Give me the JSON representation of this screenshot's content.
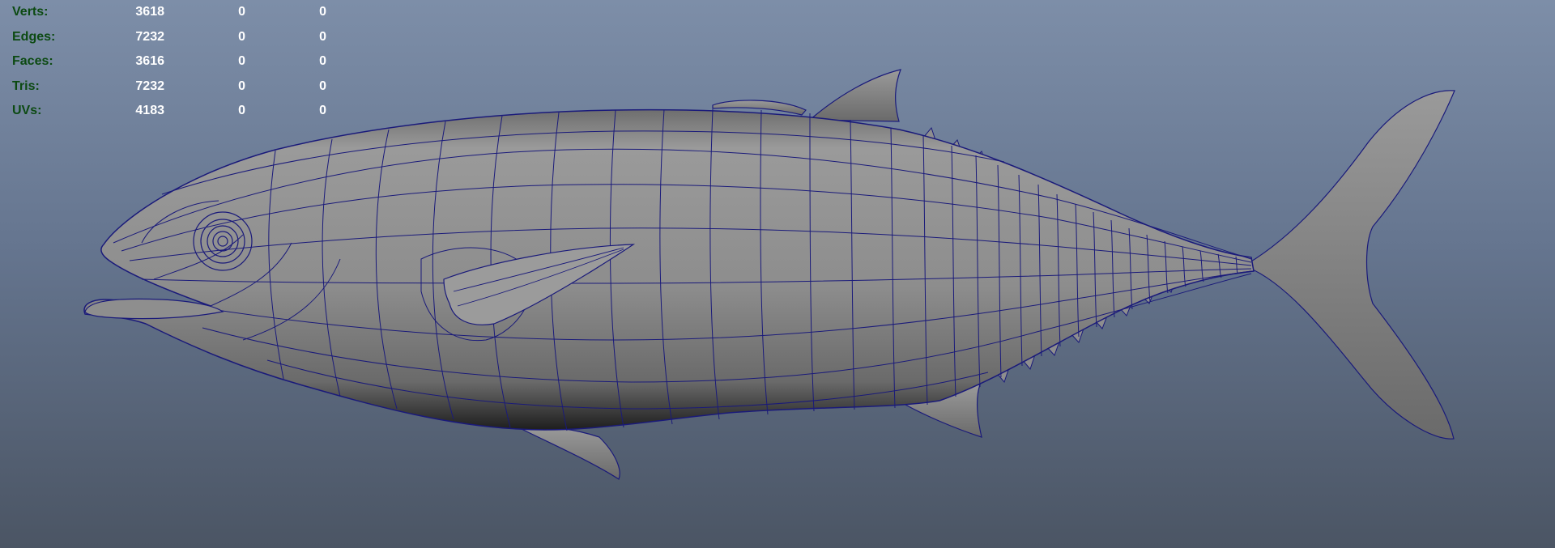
{
  "hud": {
    "rows": [
      {
        "label": "Verts:",
        "v1": "3618",
        "v2": "0",
        "v3": "0"
      },
      {
        "label": "Edges:",
        "v1": "7232",
        "v2": "0",
        "v3": "0"
      },
      {
        "label": "Faces:",
        "v1": "3616",
        "v2": "0",
        "v3": "0"
      },
      {
        "label": "Tris:",
        "v1": "7232",
        "v2": "0",
        "v3": "0"
      },
      {
        "label": "UVs:",
        "v1": "4183",
        "v2": "0",
        "v3": "0"
      }
    ]
  },
  "viewport": {
    "subject": "tuna-fish-wireframe-mesh",
    "colors": {
      "background_top": "#7d8ea8",
      "background_bottom": "#4b5564",
      "mesh_fill": "#8e8e8e",
      "wireframe": "#1a1a7a",
      "hud_label": "#0c4a12",
      "hud_value": "#ffffff"
    }
  }
}
